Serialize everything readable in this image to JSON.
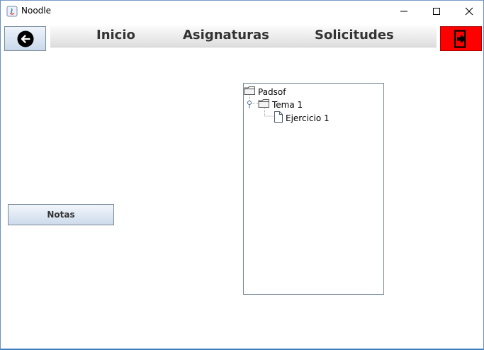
{
  "window": {
    "title": "Noodle"
  },
  "toolbar": {
    "back_icon": "arrow-left-circle-icon",
    "nav_items": [
      "Inicio",
      "Asignaturas",
      "Solicitudes"
    ],
    "exit_icon": "exit-door-icon",
    "exit_color": "#ff0000"
  },
  "buttons": {
    "notas_label": "Notas"
  },
  "tree": {
    "root": "Padsof",
    "child": "Tema 1",
    "leaf": "Ejercicio 1"
  },
  "colors": {
    "accent": "#3c7fc0",
    "exit": "#ff0000"
  }
}
